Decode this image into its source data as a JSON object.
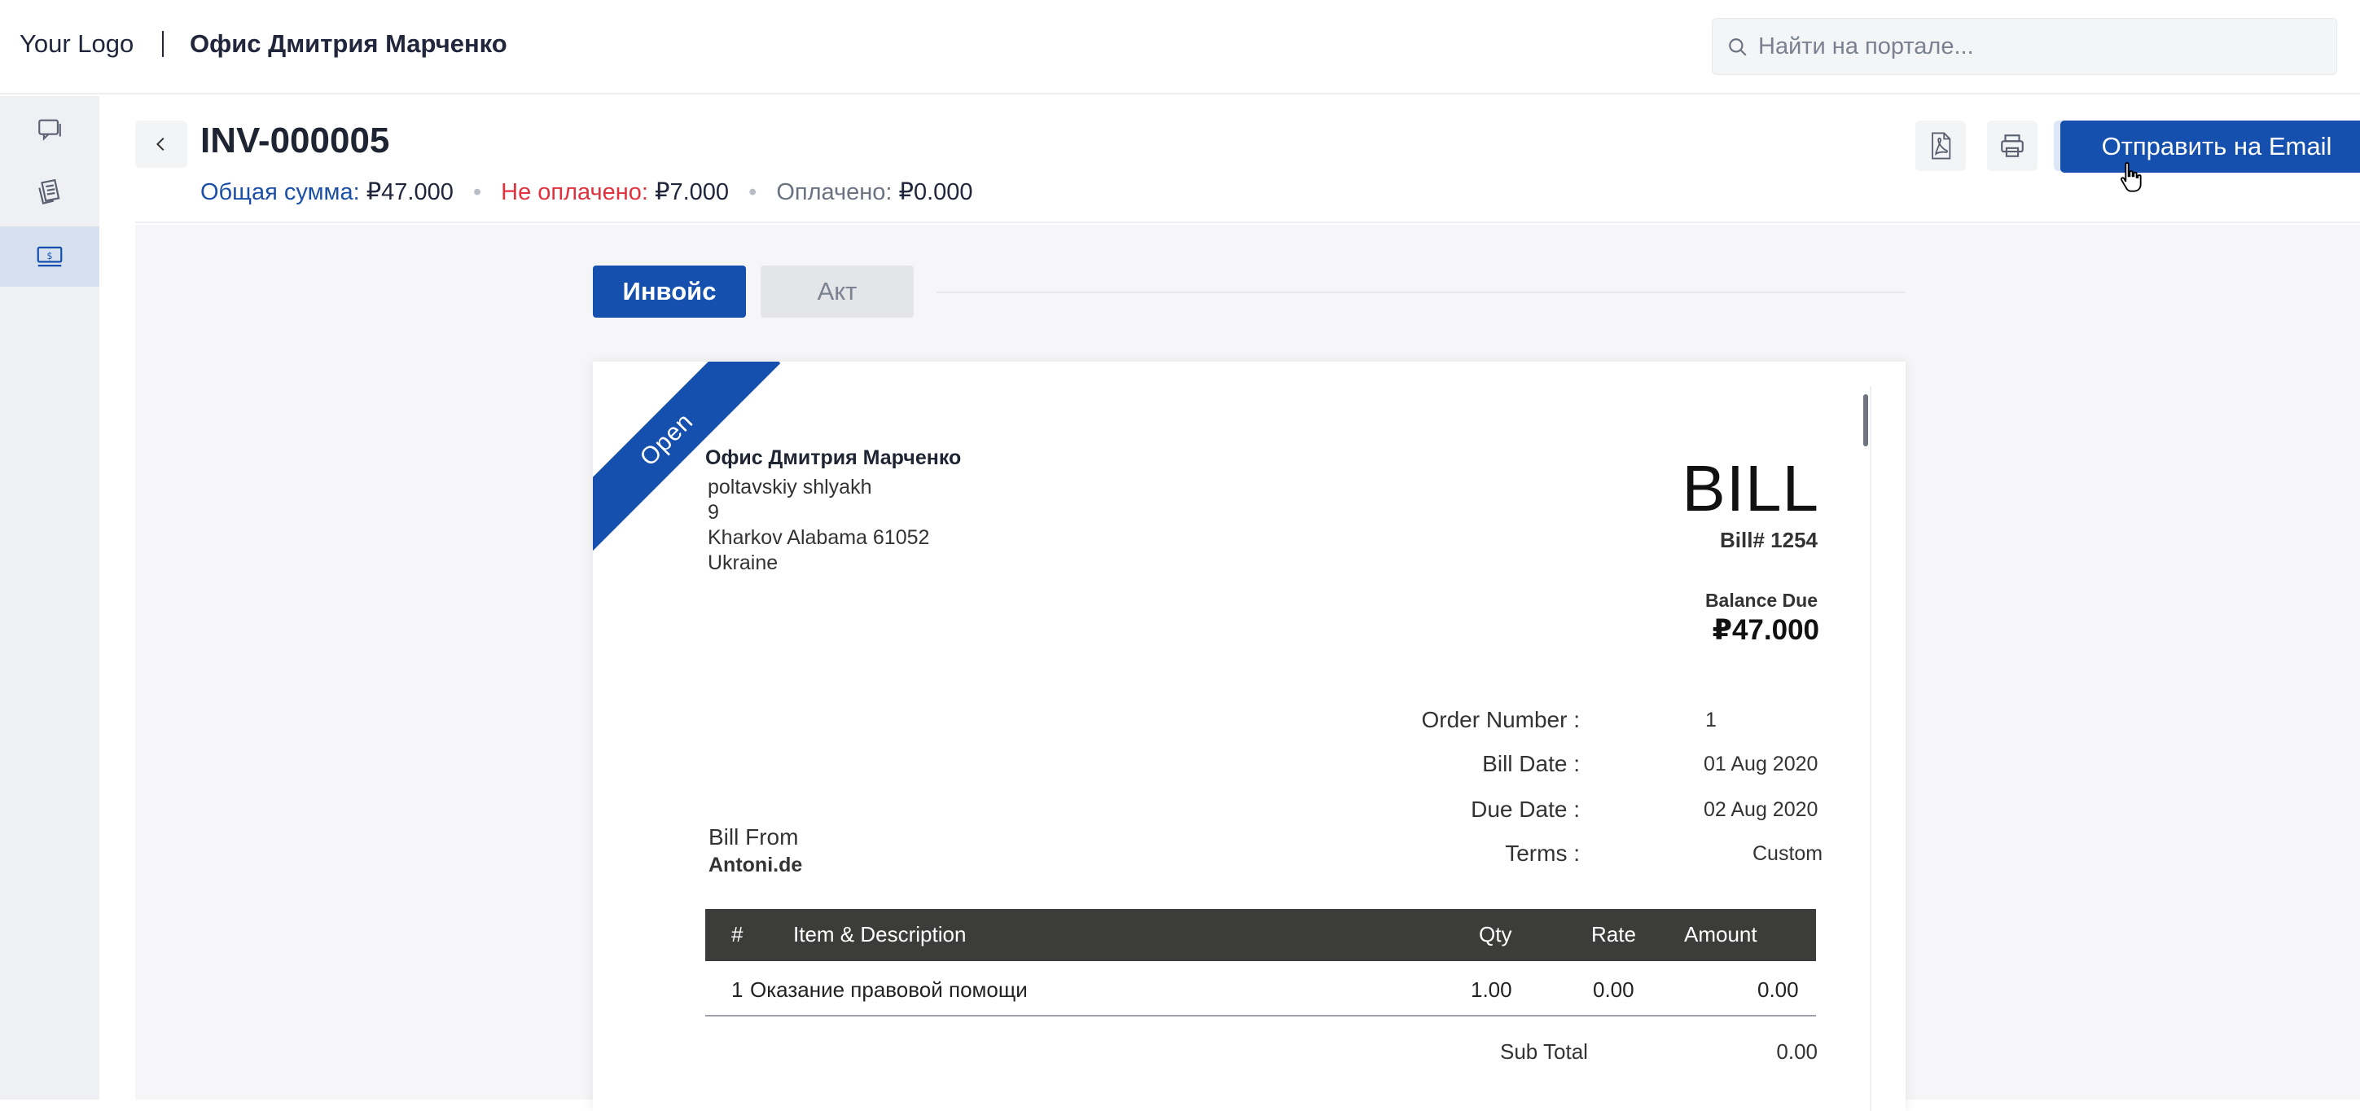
{
  "header": {
    "logo": "Your Logo",
    "org_name": "Офис Дмитрия Марченко",
    "search_placeholder": "Найти на портале..."
  },
  "sidebar": {
    "items": [
      {
        "icon": "chat-icon"
      },
      {
        "icon": "receipts-icon"
      },
      {
        "icon": "invoice-money-icon",
        "active": true
      }
    ]
  },
  "invoice_header": {
    "number": "INV-000005",
    "total_label": "Общая сумма:",
    "total_value": "₽47.000",
    "unpaid_label": "Не оплачено:",
    "unpaid_value": "₽7.000",
    "paid_label": "Оплачено:",
    "paid_value": "₽0.000",
    "send_email_label": "Отправить на Email",
    "colors": {
      "accent": "#1550ae",
      "unpaid": "#e0323e"
    }
  },
  "tabs": [
    {
      "label": "Инвойс",
      "active": true
    },
    {
      "label": "Акт",
      "active": false
    }
  ],
  "document": {
    "status_ribbon": "Open",
    "from": {
      "name": "Офис Дмитрия Марченко",
      "address_lines": [
        "poltavskiy shlyakh",
        "9",
        "Kharkov Alabama 61052",
        "Ukraine"
      ]
    },
    "title": "BILL",
    "bill_number": "Bill# 1254",
    "balance_due_label": "Balance Due",
    "balance_due_value": "₽47.000",
    "meta": [
      {
        "label": "Order Number :",
        "value": "1"
      },
      {
        "label": "Bill Date :",
        "value": "01 Aug 2020"
      },
      {
        "label": "Due Date :",
        "value": "02 Aug 2020"
      },
      {
        "label": "Terms :",
        "value": "Custom"
      }
    ],
    "bill_from_label": "Bill From",
    "bill_from_value": "Antoni.de",
    "table": {
      "headers": [
        "#",
        "Item & Description",
        "Qty",
        "Rate",
        "Amount"
      ],
      "rows": [
        [
          "1",
          "Оказание правовой помощи",
          "1.00",
          "0.00",
          "0.00"
        ]
      ]
    },
    "subtotal_label": "Sub Total",
    "subtotal_value": "0.00"
  }
}
